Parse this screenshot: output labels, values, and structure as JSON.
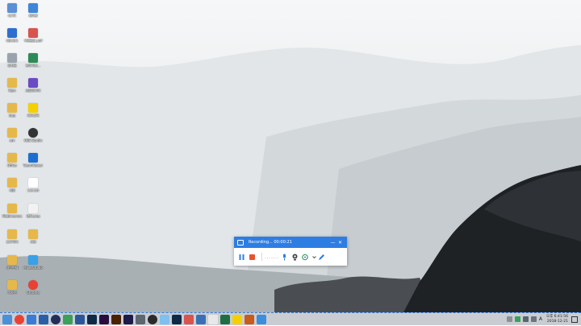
{
  "desktop": {
    "icons_col1": [
      {
        "label": "내 PC",
        "color": "#5b8fd6"
      },
      {
        "label": "네트워크",
        "color": "#2d6fcf"
      },
      {
        "label": "휴지통",
        "color": "#9aa3ad"
      },
      {
        "label": "Pgm",
        "color": "#e6b84a"
      },
      {
        "label": "bag",
        "color": "#e6b84a"
      },
      {
        "label": "am",
        "color": "#e6b84a"
      },
      {
        "label": "Office",
        "color": "#e6b84a"
      },
      {
        "label": "새폴",
        "color": "#e6b84a"
      },
      {
        "label": "Webincense",
        "color": "#e6b84a"
      },
      {
        "label": "조우작이",
        "color": "#e6b84a"
      },
      {
        "label": "사진면제",
        "color": "#e6b84a"
      },
      {
        "label": "이사진",
        "color": "#e6b84a"
      }
    ],
    "icons_col2": [
      {
        "label": "제어판",
        "color": "#3f86d9"
      },
      {
        "label": "우편물표.pdf",
        "color": "#d9534f"
      },
      {
        "label": "진미작인...",
        "color": "#2e8b57"
      },
      {
        "label": "곰플레이어",
        "color": "#6a4bc4"
      },
      {
        "label": "카카오톡",
        "color": "#f5d000"
      },
      {
        "label": "OBS Studio",
        "color": "#333333"
      },
      {
        "label": "TeamViewer",
        "color": "#1c6fd1"
      },
      {
        "label": "노트.txt",
        "color": "#ffffff"
      },
      {
        "label": "캡쳐.png",
        "color": "#f2f2f2"
      },
      {
        "label": "사진",
        "color": "#e6b84a"
      },
      {
        "label": "MixerStudio",
        "color": "#3aa0e8"
      },
      {
        "label": "Chrome",
        "color": "#e94235"
      }
    ]
  },
  "recorder": {
    "title": "Recording... 00:00:21",
    "minimize_label": "—",
    "close_label": "✕",
    "pause_color": "#2d7de3",
    "stop_color": "#e8532f",
    "dots": ".......",
    "accent": "#2d7de3"
  },
  "taskbar": {
    "apps": [
      {
        "name": "file-explorer",
        "color": "#4a90d9",
        "round": false
      },
      {
        "name": "chrome",
        "color": "#e94235",
        "round": true
      },
      {
        "name": "app-mail",
        "color": "#3a7bd5",
        "round": false
      },
      {
        "name": "app-blue",
        "color": "#2a5fa8",
        "round": false
      },
      {
        "name": "app-dark",
        "color": "#222f5a",
        "round": true
      },
      {
        "name": "app-green",
        "color": "#3aa05a",
        "round": false
      },
      {
        "name": "word",
        "color": "#2b579a",
        "round": false
      },
      {
        "name": "photoshop",
        "color": "#0e2a47",
        "round": false
      },
      {
        "name": "premiere",
        "color": "#2a0d3f",
        "round": false
      },
      {
        "name": "illustrator",
        "color": "#4a2200",
        "round": false
      },
      {
        "name": "after-effects",
        "color": "#1e1a4a",
        "round": false
      },
      {
        "name": "app-grey",
        "color": "#5e6670",
        "round": false
      },
      {
        "name": "obs",
        "color": "#2a2a2a",
        "round": true
      },
      {
        "name": "app-light",
        "color": "#7ec0f0",
        "round": false
      },
      {
        "name": "photoshop2",
        "color": "#0e2a47",
        "round": false
      },
      {
        "name": "app-red",
        "color": "#d9534f",
        "round": false
      },
      {
        "name": "app-ex",
        "color": "#3a6fb5",
        "round": false
      },
      {
        "name": "app-doc",
        "color": "#e8e8e8",
        "round": false
      },
      {
        "name": "excel",
        "color": "#1d6f42",
        "round": false
      },
      {
        "name": "kakao",
        "color": "#f5d000",
        "round": false
      },
      {
        "name": "app-paint",
        "color": "#c85a1e",
        "round": false
      },
      {
        "name": "app-blue2",
        "color": "#3b8ede",
        "round": false
      }
    ],
    "tray_input": "A",
    "time": "오후 6:41:56",
    "date": "2018-12-21"
  }
}
